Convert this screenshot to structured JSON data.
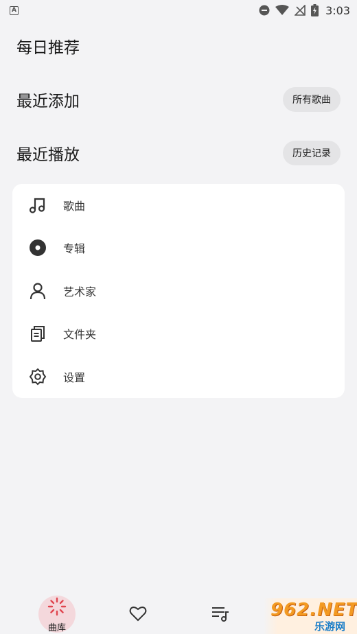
{
  "status_bar": {
    "time": "3:03",
    "left_badge": "A"
  },
  "sections": {
    "daily": {
      "title": "每日推荐"
    },
    "recent_added": {
      "title": "最近添加",
      "button": "所有歌曲"
    },
    "recent_played": {
      "title": "最近播放",
      "button": "历史记录"
    }
  },
  "library": {
    "items": [
      {
        "label": "歌曲",
        "icon": "music-note-icon"
      },
      {
        "label": "专辑",
        "icon": "album-disc-icon"
      },
      {
        "label": "艺术家",
        "icon": "person-icon"
      },
      {
        "label": "文件夹",
        "icon": "folder-files-icon"
      },
      {
        "label": "设置",
        "icon": "gear-icon"
      }
    ]
  },
  "bottom_nav": {
    "items": [
      {
        "label": "曲库",
        "icon": "library-spinner-icon",
        "active": true
      },
      {
        "label": "",
        "icon": "heart-icon",
        "active": false
      },
      {
        "label": "",
        "icon": "playlist-icon",
        "active": false
      }
    ]
  },
  "watermark": {
    "top": "962.NET",
    "bottom": "乐游网"
  },
  "colors": {
    "accent": "#e0454f",
    "card": "#ffffff",
    "background": "#f3f3f5",
    "pill": "#e4e4e6"
  }
}
